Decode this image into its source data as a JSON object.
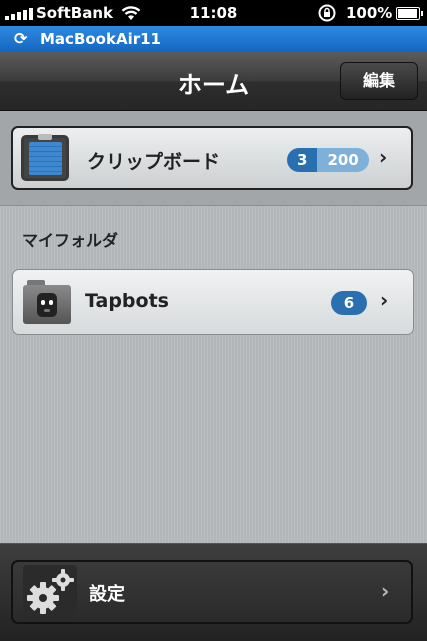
{
  "status_bar": {
    "carrier": "SoftBank",
    "time": "11:08",
    "battery": "100%",
    "icons": [
      "signal-icon",
      "wifi-icon",
      "rotation-lock-icon",
      "battery-icon"
    ]
  },
  "sync_bar": {
    "device_name": "MacBookAir11",
    "icon": "sync-icon"
  },
  "nav": {
    "title": "ホーム",
    "edit_label": "編集"
  },
  "clipboard_row": {
    "label": "クリップボード",
    "badge_primary": "3",
    "badge_secondary": "200",
    "icon": "clipboard-icon"
  },
  "my_folders": {
    "header": "マイフォルダ",
    "items": [
      {
        "label": "Tapbots",
        "count": "6",
        "icon": "folder-icon"
      }
    ]
  },
  "settings": {
    "label": "設定",
    "icon": "gear-icon"
  },
  "colors": {
    "accent_blue": "#2a6fb0",
    "badge_light_blue": "#7fb0d9",
    "sync_bar_blue": "#1f77d0"
  }
}
